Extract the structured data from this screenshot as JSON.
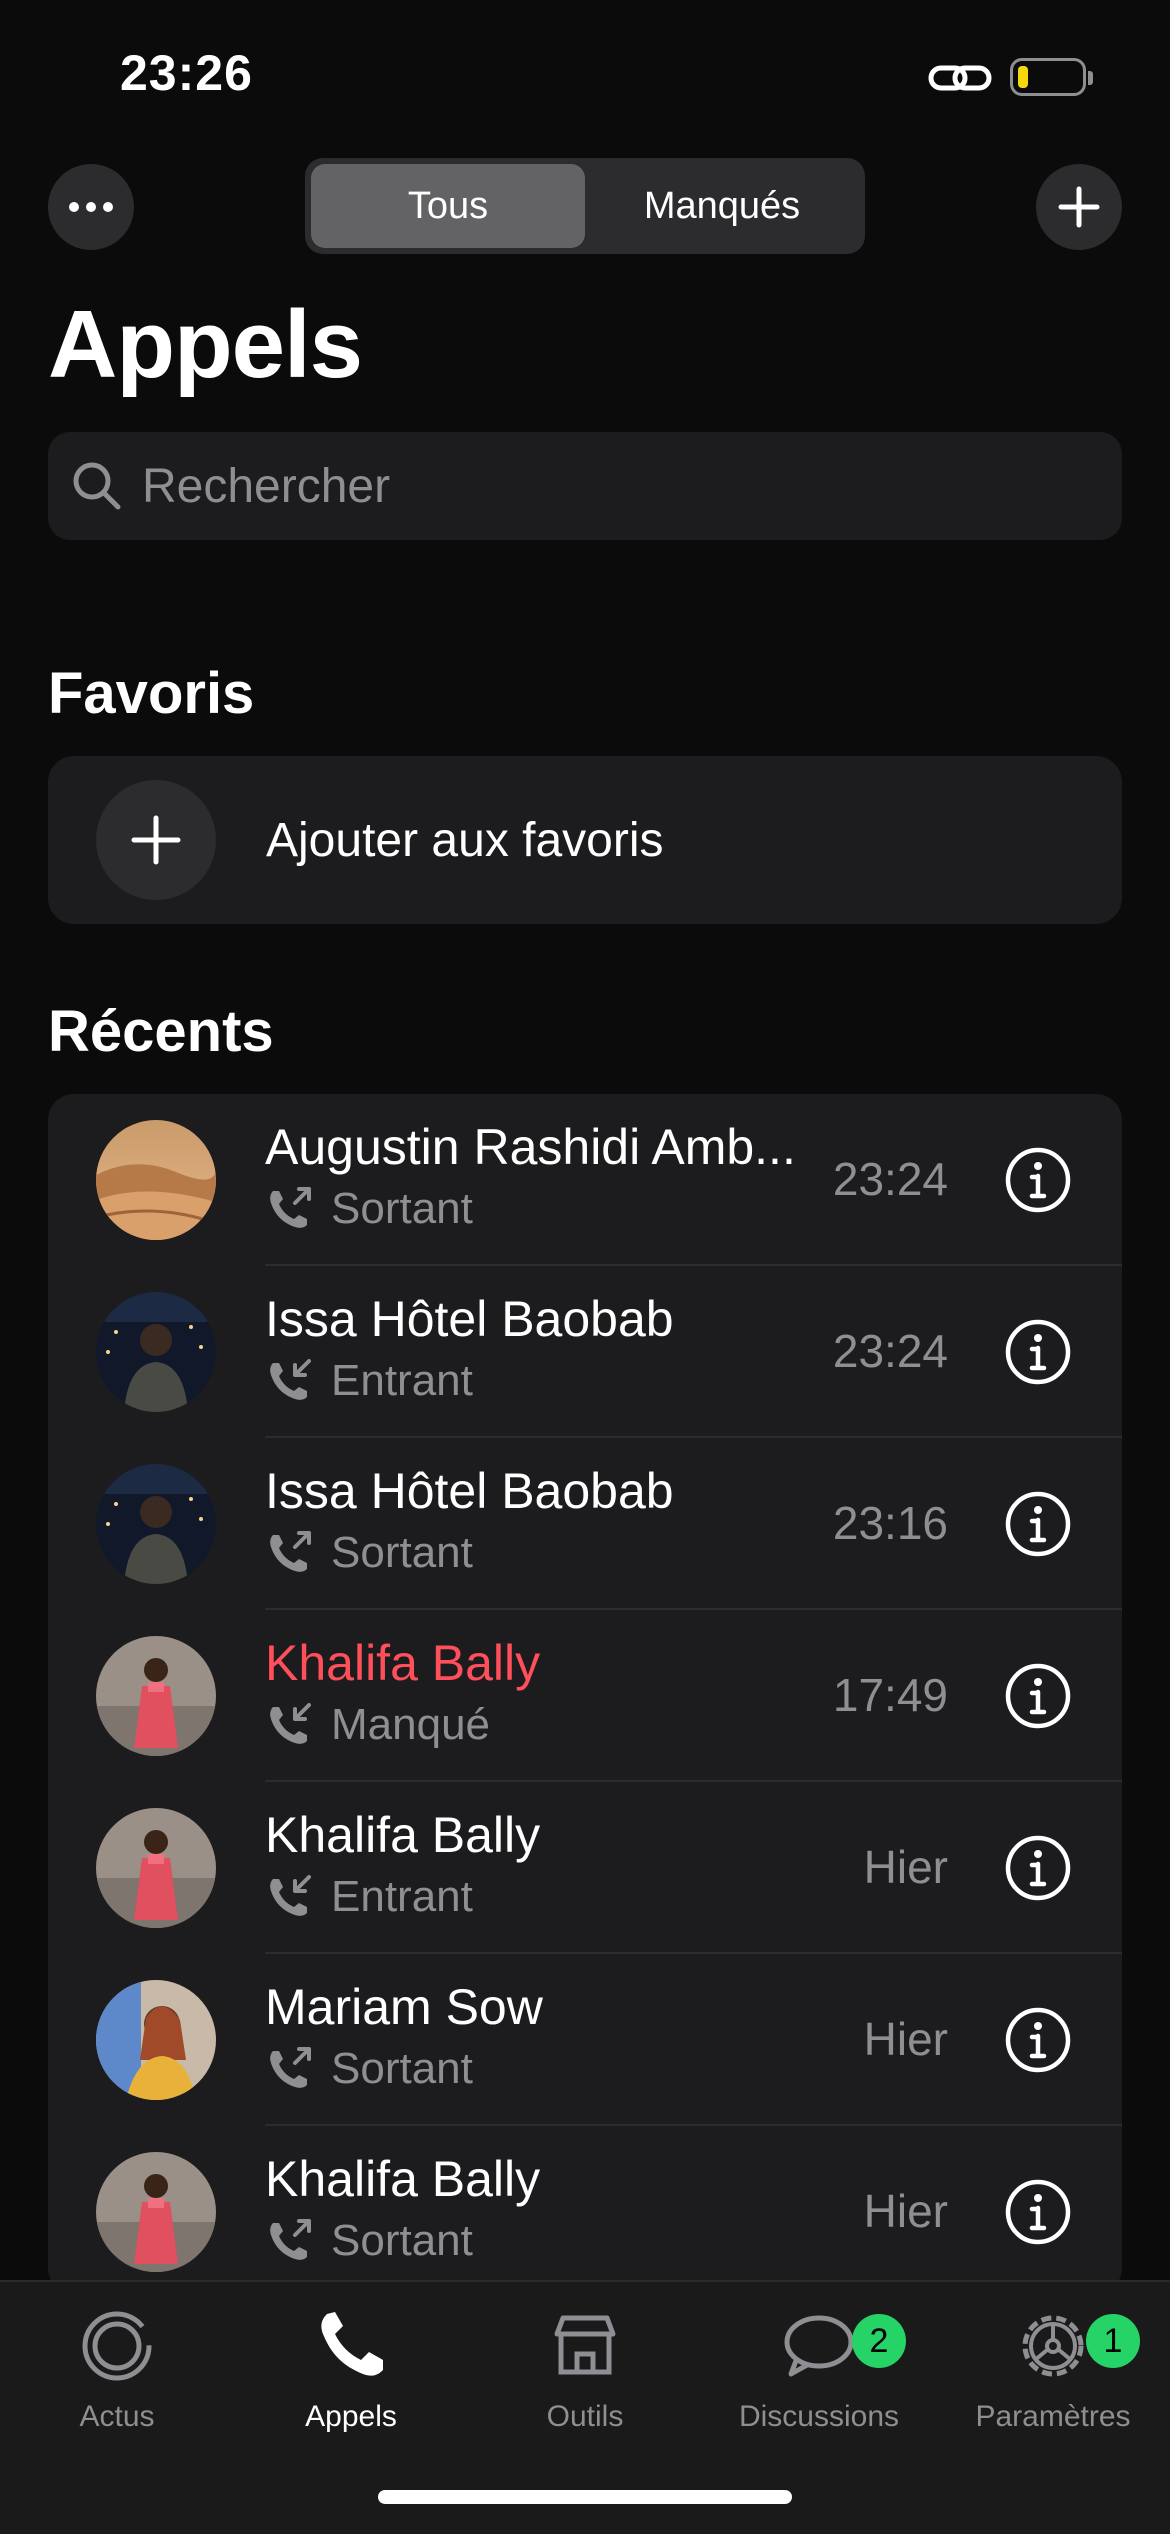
{
  "status_bar": {
    "time": "23:26"
  },
  "header": {
    "segments": [
      "Tous",
      "Manqués"
    ],
    "active_segment": "Tous",
    "title": "Appels"
  },
  "search": {
    "placeholder": "Rechercher"
  },
  "favorites": {
    "title": "Favoris",
    "add_label": "Ajouter aux favoris"
  },
  "recents": {
    "title": "Récents",
    "calls": [
      {
        "name": "Augustin Rashidi Amb...",
        "direction": "Sortant",
        "type": "outgoing",
        "time": "23:24",
        "missed": false,
        "avatar": "desert"
      },
      {
        "name": "Issa Hôtel Baobab",
        "direction": "Entrant",
        "type": "incoming",
        "time": "23:24",
        "missed": false,
        "avatar": "night-man"
      },
      {
        "name": "Issa Hôtel Baobab",
        "direction": "Sortant",
        "type": "outgoing",
        "time": "23:16",
        "missed": false,
        "avatar": "night-man"
      },
      {
        "name": "Khalifa Bally",
        "direction": "Manqué",
        "type": "incoming",
        "time": "17:49",
        "missed": true,
        "avatar": "girl-pink"
      },
      {
        "name": "Khalifa Bally",
        "direction": "Entrant",
        "type": "incoming",
        "time": "Hier",
        "missed": false,
        "avatar": "girl-pink"
      },
      {
        "name": "Mariam Sow",
        "direction": "Sortant",
        "type": "outgoing",
        "time": "Hier",
        "missed": false,
        "avatar": "woman-yellow"
      },
      {
        "name": "Khalifa Bally",
        "direction": "Sortant",
        "type": "outgoing",
        "time": "Hier",
        "missed": false,
        "avatar": "girl-pink"
      }
    ]
  },
  "tabbar": {
    "tabs": [
      {
        "label": "Actus",
        "icon": "updates-icon",
        "active": false,
        "badge": ""
      },
      {
        "label": "Appels",
        "icon": "phone-icon",
        "active": true,
        "badge": ""
      },
      {
        "label": "Outils",
        "icon": "store-icon",
        "active": false,
        "badge": ""
      },
      {
        "label": "Discussions",
        "icon": "chat-icon",
        "active": false,
        "badge": "2"
      },
      {
        "label": "Paramètres",
        "icon": "gear-icon",
        "active": false,
        "badge": "1"
      }
    ]
  },
  "colors": {
    "missed": "#ff4f5b",
    "badge": "#25d366",
    "segment_active": "#636366"
  }
}
